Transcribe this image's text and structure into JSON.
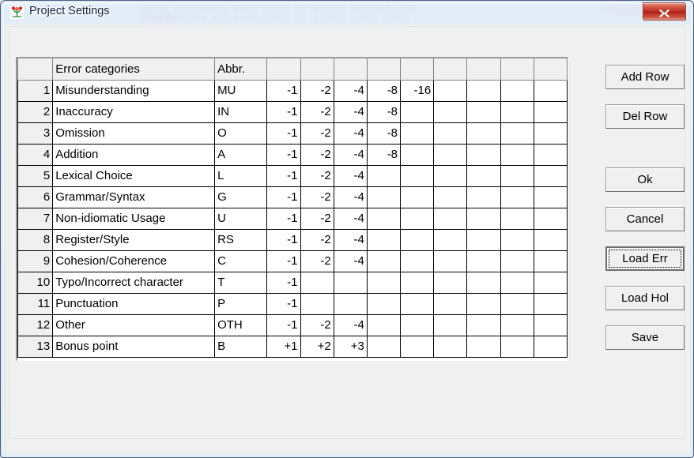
{
  "window": {
    "title": "Project Settings",
    "icon": "flower-plant-icon",
    "close_label": "x"
  },
  "grid": {
    "headers": [
      "",
      "Error categories",
      "Abbr.",
      "",
      "",
      "",
      "",
      "",
      "",
      "",
      "",
      ""
    ],
    "columns": {
      "rownum": "",
      "name": "Error categories",
      "abbr": "Abbr.",
      "numeric_count": 9
    },
    "rows": [
      {
        "n": "1",
        "name": "Misunderstanding",
        "abbr": "MU",
        "values": [
          "-1",
          "-2",
          "-4",
          "-8",
          "-16",
          "",
          "",
          "",
          ""
        ]
      },
      {
        "n": "2",
        "name": "Inaccuracy",
        "abbr": "IN",
        "values": [
          "-1",
          "-2",
          "-4",
          "-8",
          "",
          "",
          "",
          "",
          ""
        ]
      },
      {
        "n": "3",
        "name": "Omission",
        "abbr": "O",
        "values": [
          "-1",
          "-2",
          "-4",
          "-8",
          "",
          "",
          "",
          "",
          ""
        ]
      },
      {
        "n": "4",
        "name": "Addition",
        "abbr": "A",
        "values": [
          "-1",
          "-2",
          "-4",
          "-8",
          "",
          "",
          "",
          "",
          ""
        ]
      },
      {
        "n": "5",
        "name": "Lexical Choice",
        "abbr": "L",
        "values": [
          "-1",
          "-2",
          "-4",
          "",
          "",
          "",
          "",
          "",
          ""
        ]
      },
      {
        "n": "6",
        "name": "Grammar/Syntax",
        "abbr": "G",
        "values": [
          "-1",
          "-2",
          "-4",
          "",
          "",
          "",
          "",
          "",
          ""
        ]
      },
      {
        "n": "7",
        "name": "Non-idiomatic Usage",
        "abbr": "U",
        "values": [
          "-1",
          "-2",
          "-4",
          "",
          "",
          "",
          "",
          "",
          ""
        ]
      },
      {
        "n": "8",
        "name": "Register/Style",
        "abbr": "RS",
        "values": [
          "-1",
          "-2",
          "-4",
          "",
          "",
          "",
          "",
          "",
          ""
        ]
      },
      {
        "n": "9",
        "name": "Cohesion/Coherence",
        "abbr": "C",
        "values": [
          "-1",
          "-2",
          "-4",
          "",
          "",
          "",
          "",
          "",
          ""
        ]
      },
      {
        "n": "10",
        "name": "Typo/Incorrect character",
        "abbr": "T",
        "values": [
          "-1",
          "",
          "",
          "",
          "",
          "",
          "",
          "",
          ""
        ]
      },
      {
        "n": "11",
        "name": "Punctuation",
        "abbr": "P",
        "values": [
          "-1",
          "",
          "",
          "",
          "",
          "",
          "",
          "",
          ""
        ]
      },
      {
        "n": "12",
        "name": "Other",
        "abbr": "OTH",
        "values": [
          "-1",
          "-2",
          "-4",
          "",
          "",
          "",
          "",
          "",
          ""
        ]
      },
      {
        "n": "13",
        "name": "Bonus point",
        "abbr": "B",
        "values": [
          "+1",
          "+2",
          "+3",
          "",
          "",
          "",
          "",
          "",
          ""
        ]
      }
    ]
  },
  "buttons": {
    "add_row": "Add Row",
    "del_row": "Del Row",
    "ok": "Ok",
    "cancel": "Cancel",
    "load_err": "Load Err",
    "load_hol": "Load Hol",
    "save": "Save"
  },
  "colors": {
    "dialog_background": "#f0f0f0",
    "title_bar": "#dfebf7",
    "close_button": "#bd2e20",
    "grid_header": "#f0f0f0",
    "grid_line": "#000000",
    "text": "#000000"
  }
}
